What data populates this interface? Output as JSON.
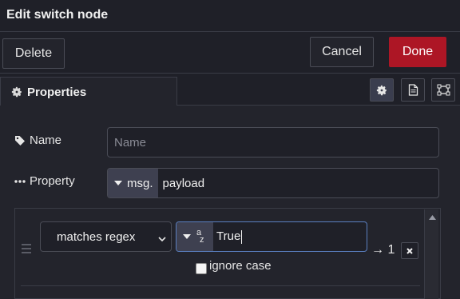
{
  "header": {
    "title": "Edit switch node"
  },
  "toolbar": {
    "delete_label": "Delete",
    "cancel_label": "Cancel",
    "done_label": "Done"
  },
  "tabs": {
    "active": {
      "label": "Properties",
      "icon": "gear-icon"
    },
    "icons": [
      "gear-icon",
      "document-icon",
      "appearance-icon"
    ]
  },
  "form": {
    "name": {
      "label": "Name",
      "icon": "tag-icon",
      "value": "",
      "placeholder": "Name"
    },
    "property": {
      "label": "Property",
      "icon": "ellipsis-icon",
      "type_prefix": "msg.",
      "value": "payload"
    }
  },
  "rules": [
    {
      "operator": "matches regex",
      "value_type_icon": "string-az-icon",
      "value": "True",
      "ignore_case_label": "ignore case",
      "ignore_case_checked": false,
      "output_arrow": "→ 1"
    }
  ],
  "colors": {
    "done_button": "#ad1625",
    "background": "#1f2028",
    "panel": "#23242c",
    "focus_border": "#5a7fc0"
  }
}
